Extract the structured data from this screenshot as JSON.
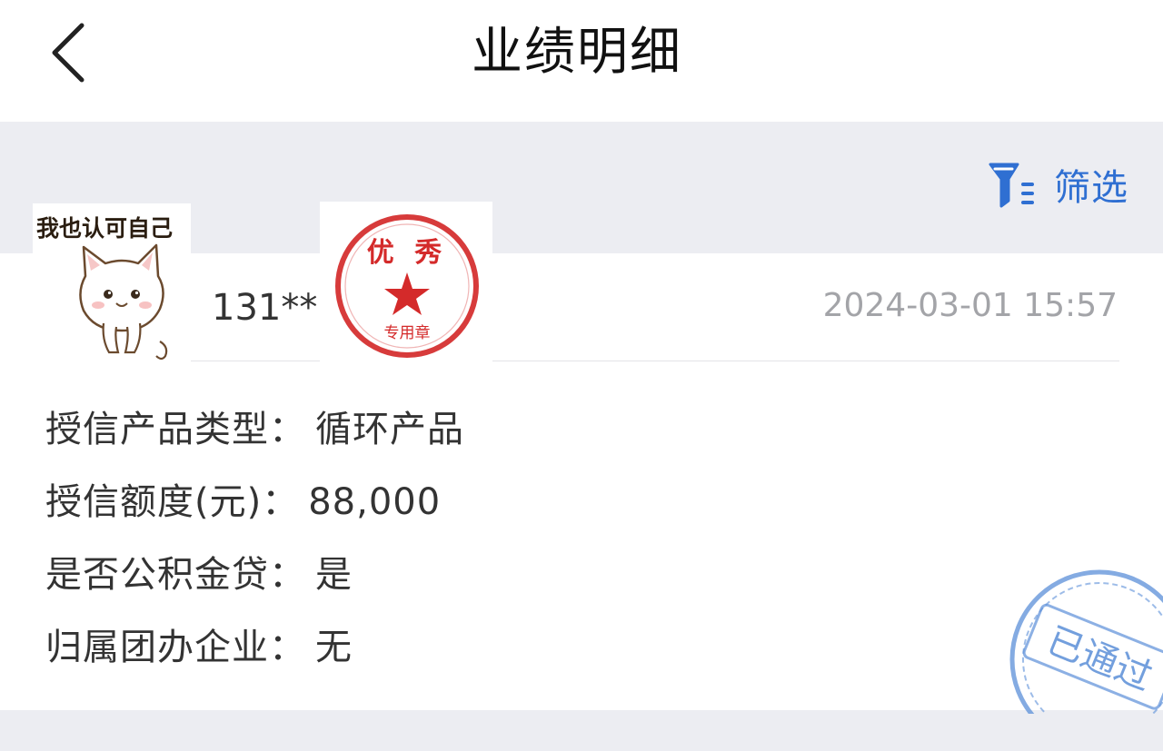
{
  "header": {
    "title": "业绩明细"
  },
  "toolbar": {
    "filter_label": "筛选"
  },
  "record": {
    "sticker_caption": "我也认可自己",
    "user_id": "131**",
    "seal": {
      "top_text": "优 秀",
      "bottom_text": "专用章"
    },
    "timestamp": "2024-03-01 15:57",
    "details": [
      {
        "label": "授信产品类型：",
        "value": "循环产品"
      },
      {
        "label": "授信额度(元)：",
        "value": "88,000"
      },
      {
        "label": "是否公积金贷：",
        "value": "是"
      },
      {
        "label": "归属团办企业：",
        "value": "无"
      }
    ],
    "approved_stamp_text": "已通过"
  },
  "colors": {
    "accent": "#2f6fd2",
    "seal_red": "#d42a2a",
    "stamp_blue": "#5b8fd8",
    "background": "#ecedf2"
  }
}
